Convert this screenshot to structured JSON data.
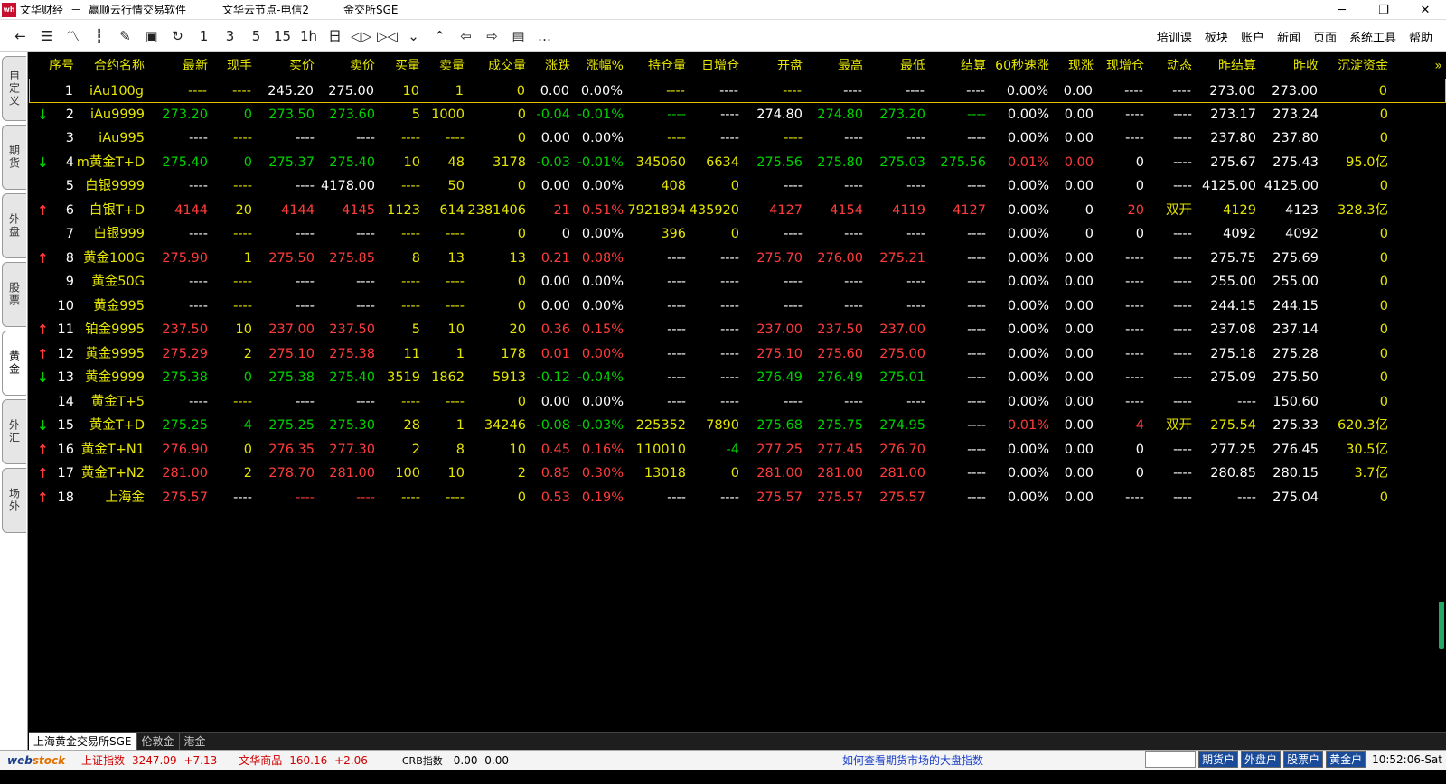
{
  "titlebar": {
    "logo": "wh",
    "segments": [
      "文华财经",
      "－",
      "赢顺云行情交易软件",
      "文华云节点-电信2",
      "金交所SGE"
    ],
    "minimize": "─",
    "maximize": "❐",
    "close": "✕"
  },
  "toolbar": {
    "tools": [
      {
        "name": "back-icon",
        "glyph": "←"
      },
      {
        "name": "report-icon",
        "glyph": "☰"
      },
      {
        "name": "line-chart-icon",
        "glyph": "〽"
      },
      {
        "name": "kline-icon",
        "glyph": "┇"
      },
      {
        "name": "order-icon",
        "glyph": "✎"
      },
      {
        "name": "save-icon",
        "glyph": "▣"
      },
      {
        "name": "refresh-icon",
        "glyph": "↻"
      },
      {
        "name": "period-1-button",
        "glyph": "1"
      },
      {
        "name": "period-3-button",
        "glyph": "3"
      },
      {
        "name": "period-5-button",
        "glyph": "5"
      },
      {
        "name": "period-15-button",
        "glyph": "15"
      },
      {
        "name": "period-1h-button",
        "glyph": "1h"
      },
      {
        "name": "period-day-button",
        "glyph": "日"
      },
      {
        "name": "zoom-in-icon",
        "glyph": "◁▷"
      },
      {
        "name": "zoom-out-icon",
        "glyph": "▷◁"
      },
      {
        "name": "down-icon",
        "glyph": "⌄"
      },
      {
        "name": "up-icon",
        "glyph": "⌃"
      },
      {
        "name": "prev-icon",
        "glyph": "⇦"
      },
      {
        "name": "next-icon",
        "glyph": "⇨"
      },
      {
        "name": "layout-icon",
        "glyph": "▤"
      },
      {
        "name": "more-icon",
        "glyph": "…"
      }
    ],
    "menus": [
      "培训课",
      "板块",
      "账户",
      "新闻",
      "页面",
      "系统工具",
      "帮助"
    ]
  },
  "left_tabs": [
    "自定义",
    "期货",
    "外盘",
    "股票",
    "黄金",
    "外汇",
    "场外"
  ],
  "active_left_tab": "黄金",
  "table": {
    "columns": [
      "序号",
      "合约名称",
      "最新",
      "现手",
      "买价",
      "卖价",
      "买量",
      "卖量",
      "成交量",
      "涨跌",
      "涨幅%",
      "持仓量",
      "日增仓",
      "开盘",
      "最高",
      "最低",
      "结算",
      "60秒速涨",
      "现涨",
      "现增仓",
      "动态",
      "昨结算",
      "昨收",
      "沉淀资金",
      "»"
    ],
    "rows": [
      {
        "arrow": "",
        "cells": [
          "1",
          "iAu100g",
          "----",
          "----",
          "245.20",
          "275.00",
          "10",
          "1",
          "0",
          "0.00",
          "0.00%",
          "----",
          "----",
          "----",
          "----",
          "----",
          "----",
          "0.00%",
          "0.00",
          "----",
          "----",
          "273.00",
          "273.00",
          "0"
        ],
        "colors": "wyyywwyyywwywywwwwwwwwwy"
      },
      {
        "arrow": "↓",
        "cells": [
          "2",
          "iAu9999",
          "273.20",
          "0",
          "273.50",
          "273.60",
          "5",
          "1000",
          "0",
          "-0.04",
          "-0.01%",
          "----",
          "----",
          "274.80",
          "274.80",
          "273.20",
          "----",
          "0.00%",
          "0.00",
          "----",
          "----",
          "273.17",
          "273.24",
          "0"
        ],
        "colors": "wyggggyyygggwwgggwwwwwwwy"
      },
      {
        "arrow": "",
        "cells": [
          "3",
          "iAu995",
          "----",
          "----",
          "----",
          "----",
          "----",
          "----",
          "0",
          "0.00",
          "0.00%",
          "----",
          "----",
          "----",
          "----",
          "----",
          "----",
          "0.00%",
          "0.00",
          "----",
          "----",
          "237.80",
          "237.80",
          "0"
        ],
        "colors": "wywywwyyywwywywwwwwwwwwy"
      },
      {
        "arrow": "↓",
        "cells": [
          "4",
          "m黄金T+D",
          "275.40",
          "0",
          "275.37",
          "275.40",
          "10",
          "48",
          "3178",
          "-0.03",
          "-0.01%",
          "345060",
          "6634",
          "275.56",
          "275.80",
          "275.03",
          "275.56",
          "0.01%",
          "0.00",
          "0",
          "----",
          "275.67",
          "275.43",
          "95.0亿"
        ],
        "colors": "wyggggyyyggyyggggrrwwwwwy"
      },
      {
        "arrow": "",
        "cells": [
          "5",
          "白银9999",
          "----",
          "----",
          "----",
          "4178.00",
          "----",
          "50",
          "0",
          "0.00",
          "0.00%",
          "408",
          "0",
          "----",
          "----",
          "----",
          "----",
          "0.00%",
          "0.00",
          "0",
          "----",
          "4125.00",
          "4125.00",
          "0"
        ],
        "colors": "wywywwyyywwyywwwwwwwwwwy"
      },
      {
        "arrow": "↑",
        "cells": [
          "6",
          "白银T+D",
          "4144",
          "20",
          "4144",
          "4145",
          "1123",
          "614",
          "2381406",
          "21",
          "0.51%",
          "7921894",
          "435920",
          "4127",
          "4154",
          "4119",
          "4127",
          "0.00%",
          "0",
          "20",
          "双开",
          "4129",
          "4123",
          "328.3亿"
        ],
        "colors": "wyryrryyyrryyrrrrwwryywwy"
      },
      {
        "arrow": "",
        "cells": [
          "7",
          "白银999",
          "----",
          "----",
          "----",
          "----",
          "----",
          "----",
          "0",
          "0",
          "0.00%",
          "396",
          "0",
          "----",
          "----",
          "----",
          "----",
          "0.00%",
          "0",
          "0",
          "----",
          "4092",
          "4092",
          "0"
        ],
        "colors": "wywywwyyywwyywwwwwwwwwwy"
      },
      {
        "arrow": "↑",
        "cells": [
          "8",
          "黄金100G",
          "275.90",
          "1",
          "275.50",
          "275.85",
          "8",
          "13",
          "13",
          "0.21",
          "0.08%",
          "----",
          "----",
          "275.70",
          "276.00",
          "275.21",
          "----",
          "0.00%",
          "0.00",
          "----",
          "----",
          "275.75",
          "275.69",
          "0"
        ],
        "colors": "wyryrryyyrrwwrrrwwwwwwwwy"
      },
      {
        "arrow": "",
        "cells": [
          "9",
          "黄金50G",
          "----",
          "----",
          "----",
          "----",
          "----",
          "----",
          "0",
          "0.00",
          "0.00%",
          "----",
          "----",
          "----",
          "----",
          "----",
          "----",
          "0.00%",
          "0.00",
          "----",
          "----",
          "255.00",
          "255.00",
          "0"
        ],
        "colors": "wywywwyyywwwwwwwwwwwwwwy"
      },
      {
        "arrow": "",
        "cells": [
          "10",
          "黄金995",
          "----",
          "----",
          "----",
          "----",
          "----",
          "----",
          "0",
          "0.00",
          "0.00%",
          "----",
          "----",
          "----",
          "----",
          "----",
          "----",
          "0.00%",
          "0.00",
          "----",
          "----",
          "244.15",
          "244.15",
          "0"
        ],
        "colors": "wywywwyyywwwwwwwwwwwwwwy"
      },
      {
        "arrow": "↑",
        "cells": [
          "11",
          "铂金9995",
          "237.50",
          "10",
          "237.00",
          "237.50",
          "5",
          "10",
          "20",
          "0.36",
          "0.15%",
          "----",
          "----",
          "237.00",
          "237.50",
          "237.00",
          "----",
          "0.00%",
          "0.00",
          "----",
          "----",
          "237.08",
          "237.14",
          "0"
        ],
        "colors": "wyryrryyyrrwwrrrwwwwwwwwy"
      },
      {
        "arrow": "↑",
        "cells": [
          "12",
          "黄金9995",
          "275.29",
          "2",
          "275.10",
          "275.38",
          "11",
          "1",
          "178",
          "0.01",
          "0.00%",
          "----",
          "----",
          "275.10",
          "275.60",
          "275.00",
          "----",
          "0.00%",
          "0.00",
          "----",
          "----",
          "275.18",
          "275.28",
          "0"
        ],
        "colors": "wyryrryyyrrwwrrrwwwwwwwwy"
      },
      {
        "arrow": "↓",
        "cells": [
          "13",
          "黄金9999",
          "275.38",
          "0",
          "275.38",
          "275.40",
          "3519",
          "1862",
          "5913",
          "-0.12",
          "-0.04%",
          "----",
          "----",
          "276.49",
          "276.49",
          "275.01",
          "----",
          "0.00%",
          "0.00",
          "----",
          "----",
          "275.09",
          "275.50",
          "0"
        ],
        "colors": "wyggggyyyggwwgggwwwwwwwwy"
      },
      {
        "arrow": "",
        "cells": [
          "14",
          "黄金T+5",
          "----",
          "----",
          "----",
          "----",
          "----",
          "----",
          "0",
          "0.00",
          "0.00%",
          "----",
          "----",
          "----",
          "----",
          "----",
          "----",
          "0.00%",
          "0.00",
          "----",
          "----",
          "----",
          "150.60",
          "0"
        ],
        "colors": "wywywwyyywwwwwwwwwwwwwwy"
      },
      {
        "arrow": "↓",
        "cells": [
          "15",
          "黄金T+D",
          "275.25",
          "4",
          "275.25",
          "275.30",
          "28",
          "1",
          "34246",
          "-0.08",
          "-0.03%",
          "225352",
          "7890",
          "275.68",
          "275.75",
          "274.95",
          "----",
          "0.01%",
          "0.00",
          "4",
          "双开",
          "275.54",
          "275.33",
          "620.3亿"
        ],
        "colors": "wyggggyyyggyyggg wrwryywwy"
      },
      {
        "arrow": "↑",
        "cells": [
          "16",
          "黄金T+N1",
          "276.90",
          "0",
          "276.35",
          "277.30",
          "2",
          "8",
          "10",
          "0.45",
          "0.16%",
          "110010",
          "-4",
          "277.25",
          "277.45",
          "276.70",
          "----",
          "0.00%",
          "0.00",
          "0",
          "----",
          "277.25",
          "276.45",
          "30.5亿"
        ],
        "colors": "wyryrryyyrryyrrrwwwwwwwwy"
      },
      {
        "arrow": "↑",
        "cells": [
          "17",
          "黄金T+N2",
          "281.00",
          "2",
          "278.70",
          "281.00",
          "100",
          "10",
          "2",
          "0.85",
          "0.30%",
          "13018",
          "0",
          "281.00",
          "281.00",
          "281.00",
          "----",
          "0.00%",
          "0.00",
          "0",
          "----",
          "280.85",
          "280.15",
          "3.7亿"
        ],
        "colors": "wyryrryyyrryyrrrwwwwwwwwy"
      },
      {
        "arrow": "↑",
        "cells": [
          "18",
          "上海金",
          "275.57",
          "----",
          "----",
          "----",
          "----",
          "----",
          "0",
          "0.53",
          "0.19%",
          "----",
          "----",
          "275.57",
          "275.57",
          "275.57",
          "----",
          "0.00%",
          "0.00",
          "----",
          "----",
          "----",
          "275.04",
          "0"
        ],
        "colors": "wyrwrryyyrrwwrrrwwwwwwwwy"
      }
    ]
  },
  "bottom_tabs": [
    "上海黄金交易所SGE",
    "伦敦金",
    "港金"
  ],
  "statusbar": {
    "brand_a": "web",
    "brand_b": "stock",
    "indices": [
      {
        "name": "上证指数",
        "value": "3247.09",
        "change": "+7.13"
      },
      {
        "name": "文华商品",
        "value": "160.16",
        "change": "+2.06"
      },
      {
        "name": "CRB指数",
        "value": "0.00",
        "change": "0.00"
      }
    ],
    "info": "如何查看期货市场的大盘指数",
    "buttons": [
      "期货户",
      "外盘户",
      "股票户",
      "黄金户"
    ],
    "clock": "10:52:06-Sat"
  },
  "colors": {
    "yellow": "#e5e500",
    "red": "#ff3c3c",
    "green": "#00d200",
    "white": "#ffffff"
  }
}
